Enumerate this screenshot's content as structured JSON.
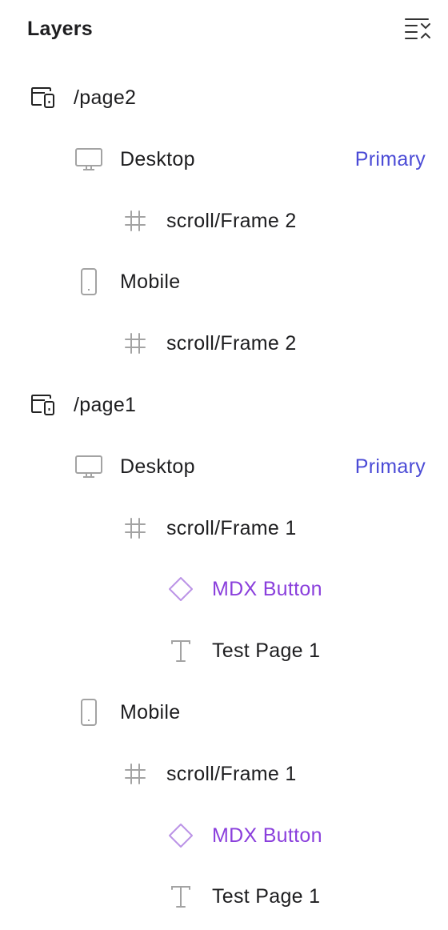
{
  "header": {
    "title": "Layers",
    "collapse_icon": "collapse-all-icon"
  },
  "colors": {
    "text": "#1d1d1f",
    "icon_gray": "#a3a3a3",
    "primary_badge": "#4b4bd6",
    "component": "#8a3fdc",
    "component_icon": "#bb93e6"
  },
  "layers": [
    {
      "type": "page",
      "icon": "page-icon",
      "label": "/page2"
    },
    {
      "type": "breakpoint",
      "icon": "desktop-icon",
      "label": "Desktop",
      "badge": "Primary"
    },
    {
      "type": "frame",
      "icon": "frame-icon",
      "label": "scroll/Frame 2"
    },
    {
      "type": "breakpoint",
      "icon": "mobile-icon",
      "label": "Mobile"
    },
    {
      "type": "frame",
      "icon": "frame-icon",
      "label": "scroll/Frame 2"
    },
    {
      "type": "page",
      "icon": "page-icon",
      "label": "/page1"
    },
    {
      "type": "breakpoint",
      "icon": "desktop-icon",
      "label": "Desktop",
      "badge": "Primary"
    },
    {
      "type": "frame",
      "icon": "frame-icon",
      "label": "scroll/Frame 1"
    },
    {
      "type": "component",
      "icon": "component-icon",
      "label": "MDX Button"
    },
    {
      "type": "text",
      "icon": "text-icon",
      "label": "Test Page 1"
    },
    {
      "type": "breakpoint",
      "icon": "mobile-icon",
      "label": "Mobile"
    },
    {
      "type": "frame",
      "icon": "frame-icon",
      "label": "scroll/Frame 1"
    },
    {
      "type": "component",
      "icon": "component-icon",
      "label": "MDX Button"
    },
    {
      "type": "text",
      "icon": "text-icon",
      "label": "Test Page 1"
    }
  ]
}
